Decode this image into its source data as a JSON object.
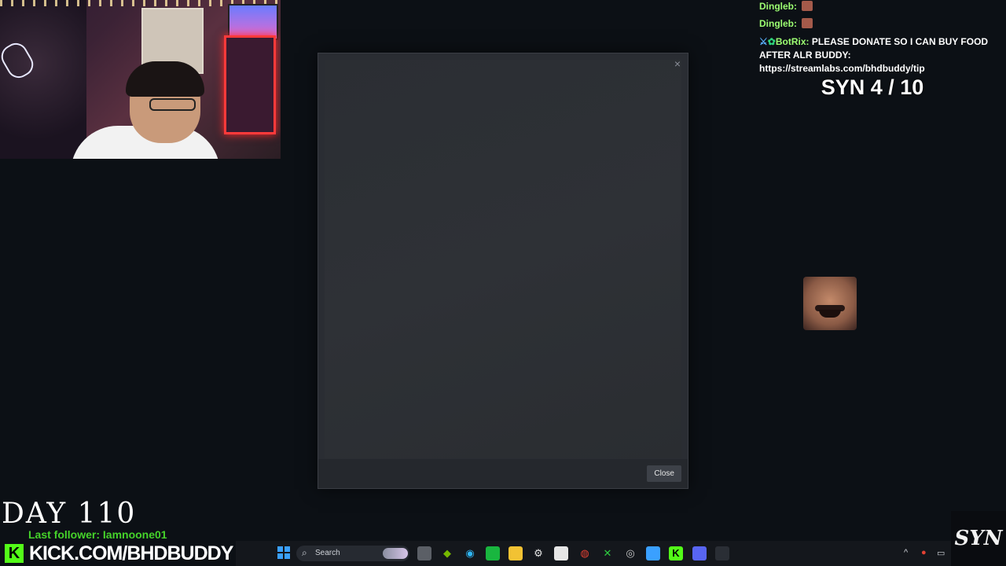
{
  "chat": {
    "messages": [
      {
        "user": "Dingleb",
        "sep": ":",
        "text": ""
      },
      {
        "user": "Dingleb",
        "sep": ":",
        "text": ""
      },
      {
        "user": "BotRix",
        "sep": ":",
        "text": "PLEASE DONATE SO I CAN BUY FOOD AFTER ALR BUDDY: https://streamlabs.com/bhdbuddy/tip"
      }
    ]
  },
  "counter": {
    "text": "SYN 4 / 10"
  },
  "dialog": {
    "close_x": "×",
    "close_label": "Close"
  },
  "overlay": {
    "day": "DAY 110",
    "follower": "Last follower: Iamnoone01",
    "kick_logo": "K",
    "kick_url": "KICK.COM/BHDBUDDY",
    "brand": "SYN"
  },
  "taskbar": {
    "search_label": "Search",
    "tray_chevron": "^"
  },
  "colors": {
    "chat_user": "#9dff72",
    "kick_green": "#53fc18",
    "follower_green": "#45d32a"
  }
}
